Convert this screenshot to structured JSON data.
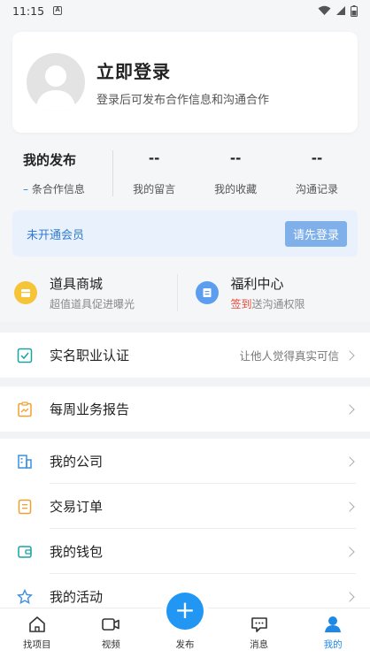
{
  "status_bar": {
    "time": "11:15",
    "sim_icon": "A"
  },
  "profile": {
    "title": "立即登录",
    "subtitle": "登录后可发布合作信息和沟通合作"
  },
  "stats": {
    "publish_title": "我的发布",
    "publish_count": "–",
    "publish_label": "条合作信息",
    "items": [
      {
        "value": "--",
        "label": "我的留言"
      },
      {
        "value": "--",
        "label": "我的收藏"
      },
      {
        "value": "--",
        "label": "沟通记录"
      }
    ]
  },
  "vip": {
    "text": "未开通会员",
    "button": "请先登录"
  },
  "quick": [
    {
      "title": "道具商城",
      "sub": "超值道具促进曝光",
      "icon": "shop-icon",
      "color": "#f6c537"
    },
    {
      "title": "福利中心",
      "sub_highlight": "签到",
      "sub": "送沟通权限",
      "icon": "list-icon",
      "color": "#5c9df0"
    }
  ],
  "menu": {
    "verify": {
      "label": "实名职业认证",
      "right": "让他人觉得真实可信",
      "icon": "check-box-icon"
    },
    "weekly": {
      "label": "每周业务报告",
      "icon": "clipboard-chart-icon"
    },
    "company": {
      "label": "我的公司",
      "icon": "building-icon"
    },
    "orders": {
      "label": "交易订单",
      "icon": "order-icon"
    },
    "wallet": {
      "label": "我的钱包",
      "icon": "wallet-icon"
    },
    "activity": {
      "label": "我的活动",
      "icon": "star-icon"
    }
  },
  "tabs": [
    {
      "label": "找项目",
      "icon": "home-icon"
    },
    {
      "label": "视频",
      "icon": "video-icon"
    },
    {
      "label": "发布",
      "icon": "plus-icon"
    },
    {
      "label": "消息",
      "icon": "message-icon"
    },
    {
      "label": "我的",
      "icon": "user-icon"
    }
  ],
  "colors": {
    "accent": "#1e88e5",
    "fab": "#2196f3",
    "vip_bg": "#e9f1fc",
    "highlight_red": "#e5493c",
    "icon_teal": "#1aa3a3",
    "icon_orange": "#f0a030",
    "icon_blue": "#3b8ee0"
  }
}
